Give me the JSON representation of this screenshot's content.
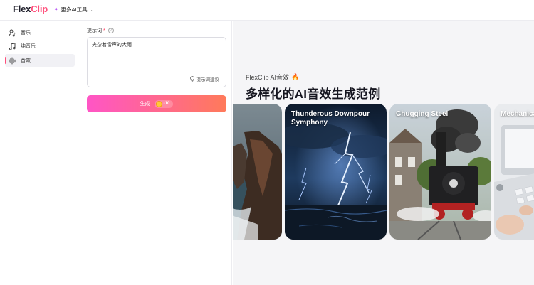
{
  "header": {
    "logo_prefix": "Flex",
    "logo_suffix": "Clip",
    "more_ai_label": "更多AI工具"
  },
  "sidebar": {
    "items": [
      {
        "label": "音乐",
        "icon": "person-music-icon",
        "active": false
      },
      {
        "label": "纯音乐",
        "icon": "music-note-icon",
        "active": false
      },
      {
        "label": "音效",
        "icon": "waveform-icon",
        "active": true
      }
    ]
  },
  "form": {
    "prompt_label": "提示词",
    "required_mark": "*",
    "help_icon": "question-icon",
    "prompt_value": "夹杂着雷声的大雨",
    "tips_label": "提示词建议",
    "generate_label": "生成",
    "credit_cost": "-10"
  },
  "main": {
    "section_subtitle": "FlexClip AI音效",
    "section_title": "多样化的AI音效生成范例",
    "cards": [
      {
        "title": ""
      },
      {
        "title": "Thunderous Downpour Symphony"
      },
      {
        "title": "Chugging Steel"
      },
      {
        "title": "Mechanica"
      }
    ]
  },
  "colors": {
    "accent": "#ff4f7b",
    "gradient_start": "#ff55c6",
    "gradient_end": "#ff7a5a"
  }
}
